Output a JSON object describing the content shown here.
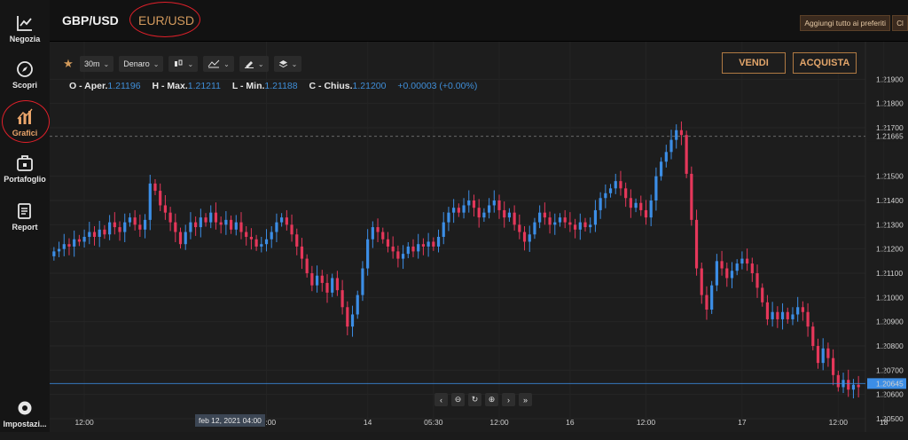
{
  "colors": {
    "up": "#3c8ee6",
    "down": "#e5375a",
    "accent": "#d39a5d",
    "bg": "#1d1d1d"
  },
  "nav": [
    {
      "label": "Negozia",
      "icon": "chart-line-icon"
    },
    {
      "label": "Scopri",
      "icon": "compass-icon"
    },
    {
      "label": "Grafici",
      "icon": "chart-bars-icon"
    },
    {
      "label": "Portafoglio",
      "icon": "briefcase-icon"
    },
    {
      "label": "Report",
      "icon": "document-icon"
    },
    {
      "label": "Impostazi...",
      "icon": "gear-icon"
    }
  ],
  "tabs": {
    "gbpusd": "GBP/USD",
    "eurusd": "EUR/USD"
  },
  "top_actions": {
    "favorites": "Aggiungi tutto ai preferiti",
    "clear": "Cl"
  },
  "toolbar": {
    "interval": "30m",
    "price_type": "Denaro"
  },
  "trade": {
    "sell": "VENDI",
    "buy": "ACQUISTA"
  },
  "ohlc": {
    "open_label": "O - Aper.",
    "open": "1.21196",
    "high_label": "H - Max.",
    "high": "1.21211",
    "low_label": "L - Min.",
    "low": "1.21188",
    "close_label": "C - Chius.",
    "close": "1.21200",
    "change": "+0.00003 (+0.00%)"
  },
  "crosshair_date": "feb 12, 2021   04:00",
  "chart_data": {
    "type": "candlestick",
    "symbol": "EUR/USD",
    "interval": "30m",
    "ylim": [
      1.205,
      1.22
    ],
    "y_ticks": [
      "1.21900",
      "1.21800",
      "1.21700",
      "1.21500",
      "1.21400",
      "1.21300",
      "1.21200",
      "1.21100",
      "1.21000",
      "1.20900",
      "1.20800",
      "1.20700",
      "1.20600",
      "1.20500"
    ],
    "y_tick_values": [
      1.219,
      1.218,
      1.217,
      1.215,
      1.214,
      1.213,
      1.212,
      1.211,
      1.21,
      1.209,
      1.208,
      1.207,
      1.206,
      1.205
    ],
    "price_markers": [
      {
        "label": "1.21665",
        "value": 1.21665,
        "color": "#7a7a7a"
      },
      {
        "label": "1.20645",
        "value": 1.20645,
        "color": "#3c8ee6"
      }
    ],
    "x_ticks": [
      "12:00",
      "12:00",
      "14",
      "05:30",
      "12:00",
      "16",
      "12:00",
      "17",
      "12:00",
      "18"
    ],
    "x_tick_index": [
      6,
      42,
      62,
      75,
      88,
      102,
      117,
      136,
      155,
      164
    ],
    "closes": [
      1.2119,
      1.212,
      1.2122,
      1.2121,
      1.2124,
      1.2123,
      1.2125,
      1.2127,
      1.2125,
      1.2128,
      1.2126,
      1.2131,
      1.2129,
      1.2127,
      1.2131,
      1.2133,
      1.213,
      1.2128,
      1.2132,
      1.2147,
      1.2144,
      1.2138,
      1.2135,
      1.2131,
      1.2127,
      1.2122,
      1.2127,
      1.2131,
      1.2129,
      1.2133,
      1.2131,
      1.2135,
      1.2131,
      1.213,
      1.2132,
      1.2128,
      1.2131,
      1.2127,
      1.2125,
      1.2124,
      1.2121,
      1.2122,
      1.2124,
      1.2127,
      1.2131,
      1.2133,
      1.213,
      1.2126,
      1.2121,
      1.2116,
      1.211,
      1.2105,
      1.2109,
      1.2106,
      1.2102,
      1.2108,
      1.2103,
      1.2096,
      1.2088,
      1.2093,
      1.2101,
      1.2112,
      1.2124,
      1.2129,
      1.2127,
      1.2124,
      1.2121,
      1.2119,
      1.2116,
      1.2118,
      1.2121,
      1.2119,
      1.2122,
      1.2121,
      1.2123,
      1.2121,
      1.2125,
      1.2131,
      1.2135,
      1.2137,
      1.2135,
      1.2138,
      1.214,
      1.2137,
      1.2133,
      1.2135,
      1.2138,
      1.214,
      1.2136,
      1.2133,
      1.2135,
      1.213,
      1.2127,
      1.2123,
      1.2126,
      1.2131,
      1.2135,
      1.2133,
      1.213,
      1.2131,
      1.2133,
      1.2131,
      1.213,
      1.2128,
      1.2131,
      1.2129,
      1.213,
      1.2136,
      1.2141,
      1.2143,
      1.2145,
      1.2148,
      1.2145,
      1.2141,
      1.2137,
      1.2139,
      1.2136,
      1.2133,
      1.214,
      1.215,
      1.2156,
      1.216,
      1.2165,
      1.2169,
      1.2167,
      1.2151,
      1.2132,
      1.2112,
      1.2101,
      1.2095,
      1.2105,
      1.2115,
      1.2112,
      1.2108,
      1.2111,
      1.2114,
      1.2116,
      1.2114,
      1.211,
      1.2104,
      1.2098,
      1.2091,
      1.2094,
      1.2091,
      1.2094,
      1.2091,
      1.2093,
      1.2096,
      1.2094,
      1.2088,
      1.208,
      1.2073,
      1.2079,
      1.2075,
      1.2068,
      1.2063,
      1.2066,
      1.2062,
      1.2064,
      1.2063
    ]
  }
}
